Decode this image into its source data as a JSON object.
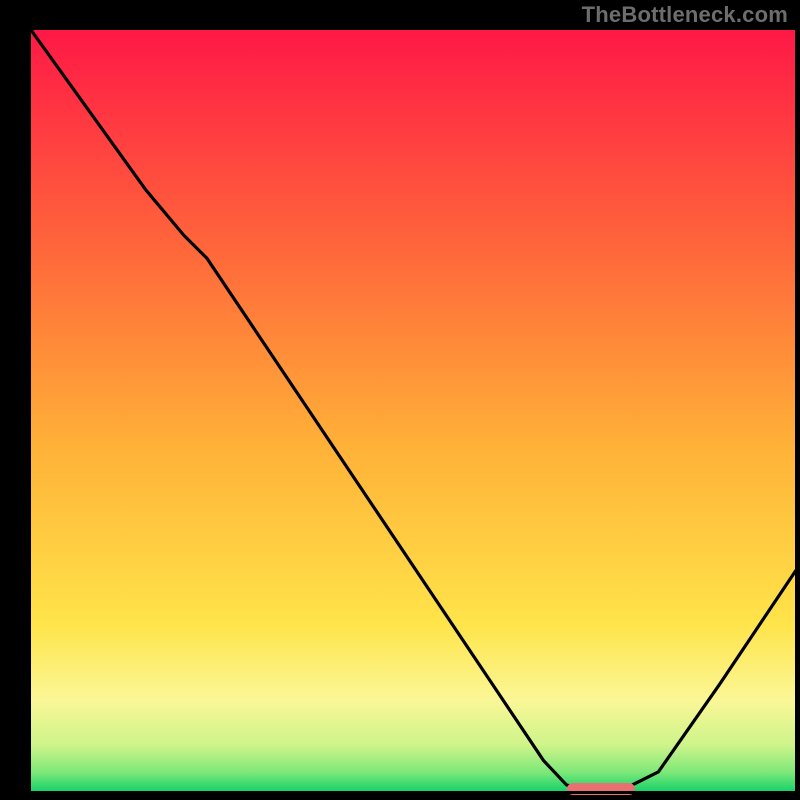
{
  "watermark": "TheBottleneck.com",
  "colors": {
    "gradient_stops": [
      {
        "offset": 0.0,
        "color": "#ff1846"
      },
      {
        "offset": 0.3,
        "color": "#ff6a3a"
      },
      {
        "offset": 0.55,
        "color": "#ffb238"
      },
      {
        "offset": 0.78,
        "color": "#ffe44a"
      },
      {
        "offset": 0.88,
        "color": "#fbf796"
      },
      {
        "offset": 0.94,
        "color": "#cdf48a"
      },
      {
        "offset": 0.975,
        "color": "#7fe879"
      },
      {
        "offset": 1.0,
        "color": "#17d36a"
      }
    ],
    "curve": "#000000",
    "marker": "#e97070",
    "frame": "#000000"
  },
  "chart_data": {
    "type": "line",
    "title": "",
    "xlabel": "",
    "ylabel": "",
    "xlim": [
      0,
      1
    ],
    "ylim": [
      0,
      1
    ],
    "x": [
      0.0,
      0.05,
      0.1,
      0.15,
      0.2,
      0.23,
      0.3,
      0.4,
      0.5,
      0.6,
      0.67,
      0.7,
      0.73,
      0.77,
      0.82,
      0.9,
      1.0
    ],
    "y": [
      1.0,
      0.93,
      0.86,
      0.79,
      0.73,
      0.7,
      0.595,
      0.445,
      0.295,
      0.145,
      0.04,
      0.008,
      0.0,
      0.0,
      0.025,
      0.14,
      0.29
    ],
    "marker_x_range": [
      0.7,
      0.79
    ],
    "marker_y": 0.003
  }
}
